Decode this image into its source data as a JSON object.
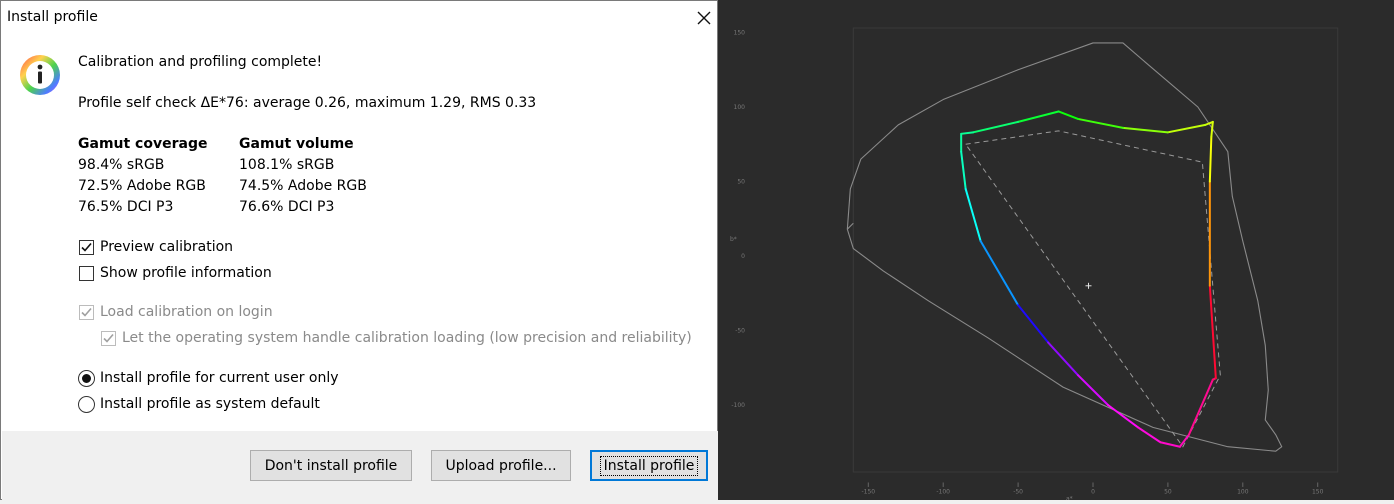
{
  "dialog": {
    "title": "Install profile",
    "heading": "Calibration and profiling complete!",
    "self_check": "Profile self check ΔE*76: average 0.26, maximum 1.29, RMS 0.33",
    "gamut_coverage": {
      "header": "Gamut coverage",
      "rows": [
        "98.4% sRGB",
        "72.5% Adobe RGB",
        "76.5% DCI P3"
      ]
    },
    "gamut_volume": {
      "header": "Gamut volume",
      "rows": [
        "108.1% sRGB",
        "74.5% Adobe RGB",
        "76.6% DCI P3"
      ]
    },
    "options": {
      "preview_calibration": {
        "label": "Preview calibration",
        "checked": true
      },
      "show_profile_information": {
        "label": "Show profile information",
        "checked": false
      },
      "load_calibration_on_login": {
        "label": "Load calibration on login",
        "checked": true,
        "disabled": true
      },
      "os_handle_calibration": {
        "label": "Let the operating system handle calibration loading (low precision and reliability)",
        "checked": true,
        "disabled": true
      }
    },
    "install_scope": {
      "current_user": {
        "label": "Install profile for current user only",
        "selected": true
      },
      "system_default": {
        "label": "Install profile as system default",
        "selected": false
      }
    },
    "buttons": {
      "dont_install": "Don't install profile",
      "upload": "Upload profile...",
      "install": "Install profile"
    }
  },
  "plot": {
    "background_color": "#2b2b2b",
    "x_ticks": [
      "-150",
      "-100",
      "-50",
      "0",
      "50",
      "100",
      "150"
    ],
    "x_tick_values": [
      -150,
      -100,
      -50,
      0,
      50,
      100,
      150
    ],
    "y_ticks": [
      "150",
      "100",
      "50",
      "0",
      "-50",
      "-100"
    ],
    "y_tick_values": [
      150,
      100,
      50,
      0,
      -50,
      -100
    ],
    "x_label": "a*",
    "y_label": "b*",
    "measured_gamut": [
      [
        -88,
        82
      ],
      [
        -88,
        70
      ],
      [
        -85,
        45
      ],
      [
        -75,
        10
      ],
      [
        -50,
        -33
      ],
      [
        -30,
        -58
      ],
      [
        -10,
        -80
      ],
      [
        10,
        -100
      ],
      [
        30,
        -115
      ],
      [
        45,
        -125
      ],
      [
        58,
        -128
      ],
      [
        64,
        -120
      ],
      [
        80,
        -83
      ],
      [
        82,
        -82
      ],
      [
        78,
        -20
      ],
      [
        78,
        50
      ],
      [
        79,
        80
      ],
      [
        80,
        90
      ],
      [
        75,
        88
      ],
      [
        50,
        83
      ],
      [
        20,
        86
      ],
      [
        -10,
        92
      ],
      [
        -23,
        97
      ],
      [
        -50,
        90
      ],
      [
        -80,
        83
      ],
      [
        -88,
        82
      ]
    ],
    "reference_gamut": [
      [
        -85,
        75
      ],
      [
        -23,
        84
      ],
      [
        73,
        63
      ],
      [
        85,
        -80
      ],
      [
        60,
        -128
      ],
      [
        -85,
        75
      ]
    ],
    "white_point": [
      -3,
      -20
    ],
    "spectral_locus": [
      [
        -160,
        22
      ],
      [
        -164,
        18
      ],
      [
        -162,
        45
      ],
      [
        -155,
        65
      ],
      [
        -130,
        88
      ],
      [
        -100,
        105
      ],
      [
        -50,
        125
      ],
      [
        0,
        143
      ],
      [
        20,
        143
      ],
      [
        35,
        130
      ],
      [
        70,
        100
      ],
      [
        90,
        70
      ],
      [
        93,
        40
      ],
      [
        100,
        10
      ],
      [
        110,
        -30
      ],
      [
        115,
        -60
      ],
      [
        117,
        -90
      ],
      [
        115,
        -110
      ],
      [
        122,
        -120
      ],
      [
        126,
        -128
      ],
      [
        122,
        -131
      ],
      [
        90,
        -128
      ],
      [
        40,
        -115
      ],
      [
        -20,
        -88
      ],
      [
        -70,
        -55
      ],
      [
        -110,
        -30
      ],
      [
        -140,
        -10
      ],
      [
        -160,
        5
      ],
      [
        -164,
        18
      ]
    ]
  }
}
